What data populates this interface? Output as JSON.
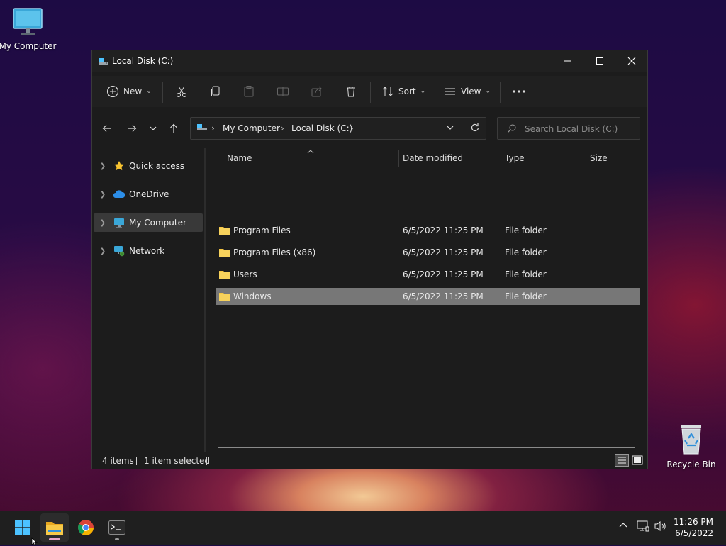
{
  "desktop": {
    "my_computer_label": "My Computer",
    "recycle_bin_label": "Recycle Bin"
  },
  "window": {
    "title": "Local Disk (C:)"
  },
  "toolbar": {
    "new_label": "New",
    "sort_label": "Sort",
    "view_label": "View"
  },
  "address": {
    "crumbs": [
      "My Computer",
      "Local Disk (C:)"
    ]
  },
  "search": {
    "placeholder": "Search Local Disk (C:)"
  },
  "sidebar": {
    "items": [
      {
        "label": "Quick access",
        "icon": "star-icon"
      },
      {
        "label": "OneDrive",
        "icon": "cloud-icon"
      },
      {
        "label": "My Computer",
        "icon": "monitor-icon",
        "selected": true
      },
      {
        "label": "Network",
        "icon": "network-icon"
      }
    ]
  },
  "columns": {
    "name": "Name",
    "date_modified": "Date modified",
    "type": "Type",
    "size": "Size"
  },
  "files": [
    {
      "name": "Program Files",
      "date": "6/5/2022 11:25 PM",
      "type": "File folder"
    },
    {
      "name": "Program Files (x86)",
      "date": "6/5/2022 11:25 PM",
      "type": "File folder"
    },
    {
      "name": "Users",
      "date": "6/5/2022 11:25 PM",
      "type": "File folder"
    },
    {
      "name": "Windows",
      "date": "6/5/2022 11:25 PM",
      "type": "File folder",
      "selected": true
    }
  ],
  "status": {
    "items_count": "4 items",
    "selected_count": "1 item selected"
  },
  "taskbar": {
    "time": "11:26 PM",
    "date": "6/5/2022"
  },
  "colors": {
    "folder": "#f5c542",
    "accent": "#4cc2ff",
    "selected_row": "#777777"
  }
}
